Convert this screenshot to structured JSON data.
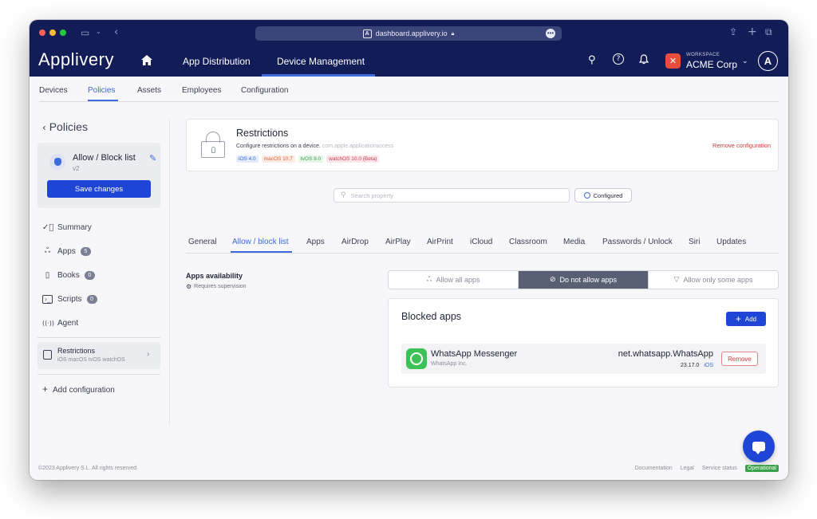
{
  "browser": {
    "url": "dashboard.applivery.io",
    "colors": {
      "close": "#ff5f57",
      "minimize": "#febc2e",
      "zoom": "#28c840"
    }
  },
  "header": {
    "logo": "Applivery",
    "tabs": [
      "App Distribution",
      "Device Management"
    ],
    "active_tab": "Device Management",
    "workspace_label": "WORKSPACE",
    "workspace_name": "ACME Corp"
  },
  "subnav": {
    "tabs": [
      "Devices",
      "Policies",
      "Assets",
      "Employees",
      "Configuration"
    ],
    "active": "Policies"
  },
  "sidebar": {
    "back_label": "Policies",
    "policy": {
      "title": "Allow / Block list",
      "version": "v2",
      "save_label": "Save changes"
    },
    "items": [
      {
        "label": "Summary",
        "icon": "check-circle-icon"
      },
      {
        "label": "Apps",
        "count": "5",
        "icon": "apps-icon"
      },
      {
        "label": "Books",
        "count": "0",
        "icon": "book-icon"
      },
      {
        "label": "Scripts",
        "count": "0",
        "icon": "terminal-icon"
      },
      {
        "label": "Agent",
        "icon": "broadcast-icon"
      }
    ],
    "restrictions": {
      "title": "Restrictions",
      "platforms": "iOS macOS tvOS watchOS"
    },
    "add_config": "Add configuration"
  },
  "restrictions_card": {
    "title": "Restrictions",
    "description": "Configure restrictions on a device.",
    "payload": "com.apple.applicationaccess",
    "chips": [
      "iOS 4.0",
      "macOS 10.7",
      "tvOS 9.0",
      "watchOS 10.0 (Beta)"
    ],
    "remove_label": "Remove configuration"
  },
  "search": {
    "placeholder": "Search property",
    "filter_label": "Configured"
  },
  "property_tabs": {
    "items": [
      "General",
      "Allow / block list",
      "Apps",
      "AirDrop",
      "AirPlay",
      "AirPrint",
      "iCloud",
      "Classroom",
      "Media",
      "Passwords / Unlock",
      "Siri",
      "Updates"
    ],
    "active": "Allow / block list"
  },
  "availability": {
    "title": "Apps availability",
    "note": "Requires supervision",
    "options": [
      "Allow all apps",
      "Do not allow apps",
      "Allow only some apps"
    ],
    "selected": "Do not allow apps"
  },
  "blocked_apps": {
    "title": "Blocked apps",
    "add_label": "Add",
    "apps": [
      {
        "name": "WhatsApp Messenger",
        "developer": "WhatsApp Inc.",
        "bundle_id": "net.whatsapp.WhatsApp",
        "version": "23.17.0",
        "platform": "iOS",
        "remove_label": "Remove"
      }
    ]
  },
  "footer": {
    "copyright": "©2023 Applivery S.L. All rights reserved.",
    "links": [
      "Documentation",
      "Legal",
      "Service status"
    ],
    "status": "Operational"
  }
}
